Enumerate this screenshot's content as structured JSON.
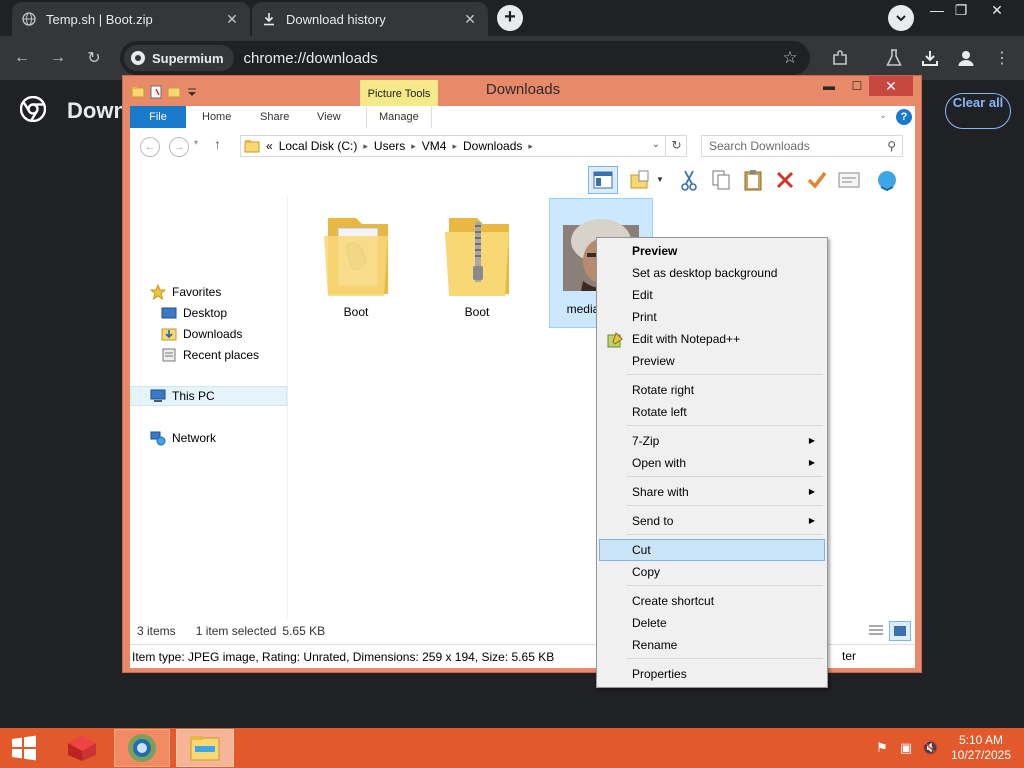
{
  "browser": {
    "tabs": [
      {
        "title": "Temp.sh | Boot.zip",
        "icon": "globe-icon"
      },
      {
        "title": "Download history",
        "icon": "download-icon"
      }
    ],
    "site_chip": "Supermium",
    "url": "chrome://downloads",
    "page_title": "Downloads",
    "clear_all": "Clear all"
  },
  "explorer": {
    "title": "Downloads",
    "contextual_tab": "Picture Tools",
    "ribbon_tabs": [
      "File",
      "Home",
      "Share",
      "View",
      "Manage"
    ],
    "address": {
      "prefix": "«",
      "crumbs": [
        "Local Disk (C:)",
        "Users",
        "VM4",
        "Downloads"
      ]
    },
    "search_placeholder": "Search Downloads",
    "nav": {
      "favorites": "Favorites",
      "desktop": "Desktop",
      "downloads": "Downloads",
      "recent": "Recent places",
      "this_pc": "This PC",
      "network": "Network"
    },
    "files": [
      {
        "name": "Boot",
        "kind": "zip-folder"
      },
      {
        "name": "Boot",
        "kind": "zip-folder"
      },
      {
        "name": "media_i…rra",
        "kind": "jpeg-thumbnail"
      }
    ],
    "status": {
      "items": "3 items",
      "selected": "1 item selected",
      "size": "5.65 KB"
    },
    "details": "Item type: JPEG image, Rating: Unrated, Dimensions: 259 x 194, Size: 5.65 KB",
    "details_tail": "ter"
  },
  "context_menu": {
    "items": [
      "Preview",
      "Set as desktop background",
      "Edit",
      "Print",
      "Edit with Notepad++",
      "Preview",
      "Rotate right",
      "Rotate left",
      "7-Zip",
      "Open with",
      "Share with",
      "Send to",
      "Cut",
      "Copy",
      "Create shortcut",
      "Delete",
      "Rename",
      "Properties"
    ],
    "highlighted": "Cut"
  },
  "taskbar": {
    "time": "5:10 AM",
    "date": "10/27/2025"
  },
  "colors": {
    "explorer_frame": "#e8896a",
    "taskbar": "#e25a2b",
    "chrome_dark": "#202124",
    "accent_blue": "#1979ca"
  }
}
